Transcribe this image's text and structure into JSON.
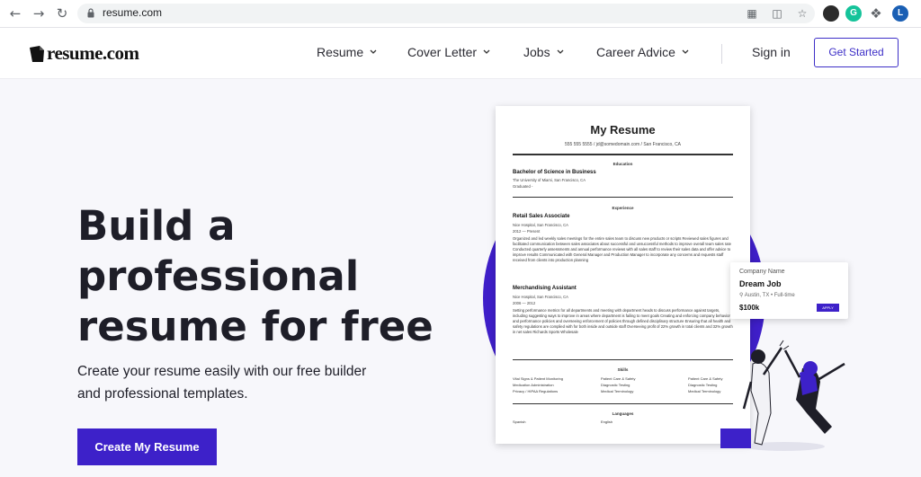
{
  "browser": {
    "url": "resume.com",
    "profile_initial": "L",
    "extension_initial": "G"
  },
  "header": {
    "logo_text": "resume.com",
    "menu": [
      {
        "label": "Resume"
      },
      {
        "label": "Cover Letter"
      },
      {
        "label": "Jobs"
      },
      {
        "label": "Career Advice"
      }
    ],
    "sign_in": "Sign in",
    "get_started": "Get Started"
  },
  "hero": {
    "title_lines": [
      "Build a",
      "professional",
      "resume for free"
    ],
    "subtitle_lines": [
      "Create your resume easily with our free builder",
      "and professional templates."
    ],
    "cta": "Create My Resume"
  },
  "resume_preview": {
    "title": "My Resume",
    "contact": "555 555 5555 / jd@somedomain.com / San Francisco, CA",
    "education_header": "Education",
    "degree": "Bachelor of Science in Business",
    "school": "The University of Miami, San Francisco, CA",
    "graduated": "Graduated -",
    "experience_header": "Experience",
    "job1": {
      "title": "Retail Sales Associate",
      "employer": "Nice Hospital, San Francisco, CA",
      "dates": "2012 — Present",
      "bullets": "Organized and led weekly sales meetings for the entire sales team to discuss new products or scripts Reviewed sales figures and facilitated communication between sales associates about successful and unsuccessful methods to improve overall team sales rate Conducted quarterly assessments and annual performance reviews with all sales staff to review their sales data and offer advice to improve results Communicated with General Manager and Production Manager to incorporate any concerns and requests staff received from clients into production planning"
    },
    "job2": {
      "title": "Merchandising Assistant",
      "employer": "Nice Hospital, San Francisco, CA",
      "dates": "2006 — 2012",
      "bullets": "Setting performance metrics for all departments and meeting with department heads to discuss performance against targets, including suggesting ways to improve in areas where department is failing to meet goals Creating and enforcing company behavior and performance policies and overseeing enforcement of policies through defined disciplinary structure Ensuring that all health and safety regulations are complied with for both inside and outside staff Overseeing profit of 22% growth in total clients and 32% growth in net sales Richards Sports Wholesale"
    },
    "skills_header": "Skills",
    "skills": [
      "Vital Signs & Patient Monitoring",
      "Patient Care & Safety",
      "Patient Care & Safety",
      "Medication Administration",
      "Diagnostic Testing",
      "Diagnostic Testing",
      "Privacy / HIPAA Regulations",
      "Medical Terminology",
      "Medical Terminology"
    ],
    "languages_header": "Languages",
    "languages": [
      "Spanish",
      "English"
    ]
  },
  "job_card": {
    "company": "Company Name",
    "title": "Dream Job",
    "location": "Austin, TX • Full-time",
    "salary": "$100k",
    "apply": "APPLY"
  }
}
